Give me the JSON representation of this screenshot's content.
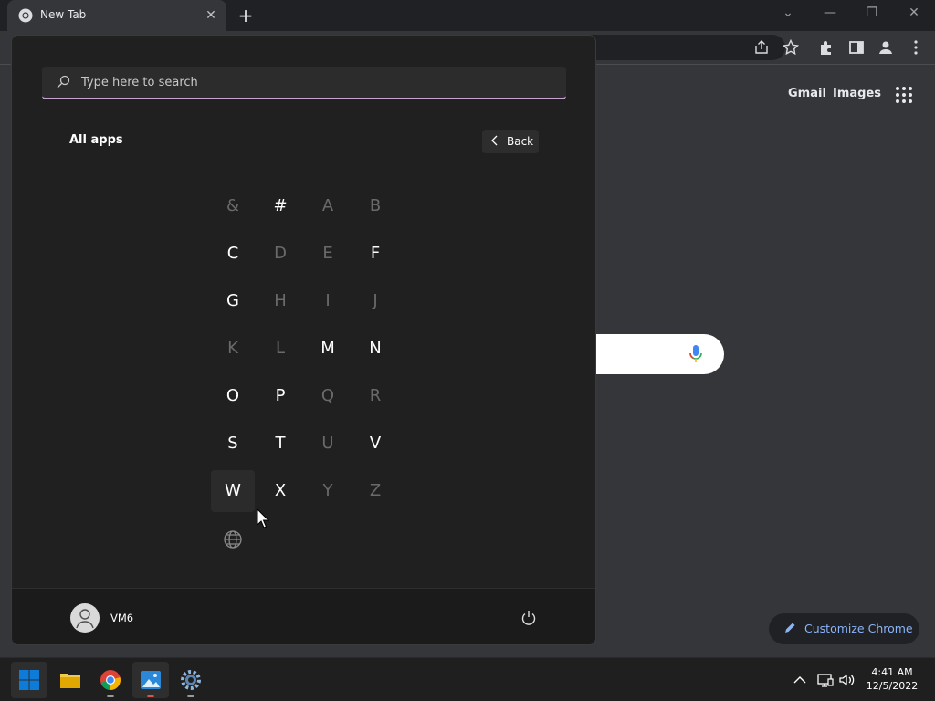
{
  "browser": {
    "tab_title": "New Tab",
    "ntp_links": {
      "gmail": "Gmail",
      "images": "Images"
    },
    "customize_label": "Customize Chrome"
  },
  "start_menu": {
    "search_placeholder": "Type here to search",
    "all_apps_label": "All apps",
    "back_label": "Back",
    "letters": [
      {
        "char": "&",
        "enabled": false
      },
      {
        "char": "#",
        "enabled": true
      },
      {
        "char": "A",
        "enabled": false
      },
      {
        "char": "B",
        "enabled": false
      },
      {
        "char": "C",
        "enabled": true
      },
      {
        "char": "D",
        "enabled": false
      },
      {
        "char": "E",
        "enabled": false
      },
      {
        "char": "F",
        "enabled": true
      },
      {
        "char": "G",
        "enabled": true
      },
      {
        "char": "H",
        "enabled": false
      },
      {
        "char": "I",
        "enabled": false
      },
      {
        "char": "J",
        "enabled": false
      },
      {
        "char": "K",
        "enabled": false
      },
      {
        "char": "L",
        "enabled": false
      },
      {
        "char": "M",
        "enabled": true
      },
      {
        "char": "N",
        "enabled": true
      },
      {
        "char": "O",
        "enabled": true
      },
      {
        "char": "P",
        "enabled": true
      },
      {
        "char": "Q",
        "enabled": false
      },
      {
        "char": "R",
        "enabled": false
      },
      {
        "char": "S",
        "enabled": true
      },
      {
        "char": "T",
        "enabled": true
      },
      {
        "char": "U",
        "enabled": false
      },
      {
        "char": "V",
        "enabled": true
      },
      {
        "char": "W",
        "enabled": true,
        "hovered": true
      },
      {
        "char": "X",
        "enabled": true
      },
      {
        "char": "Y",
        "enabled": false
      },
      {
        "char": "Z",
        "enabled": false
      }
    ],
    "globe_icon": "globe-icon",
    "user_name": "VM6"
  },
  "taskbar": {
    "apps": [
      "start-icon",
      "file-explorer-icon",
      "chrome-icon",
      "photos-icon",
      "settings-icon"
    ],
    "time": "4:41 AM",
    "date": "12/5/2022"
  },
  "colors": {
    "accent_underline": "#c7a3d0",
    "link_blue": "#8ab4f8",
    "windows_blue": "#0f7bd8"
  }
}
